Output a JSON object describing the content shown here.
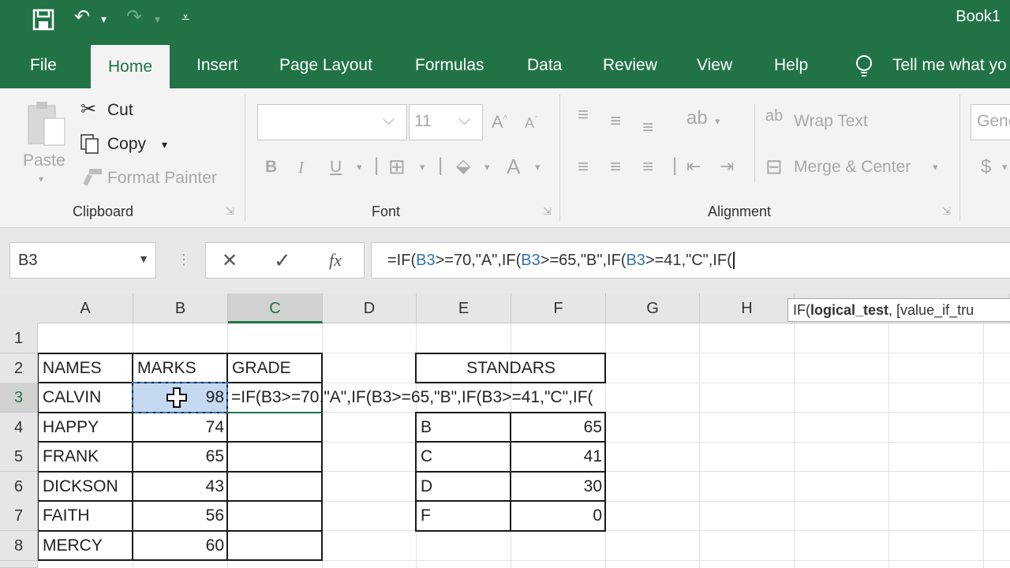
{
  "window": {
    "title": "Book1"
  },
  "qat": {
    "save_icon": "save-icon",
    "undo_icon": "undo-icon",
    "redo_icon": "redo-icon",
    "customize_icon": "customize-qat-icon"
  },
  "menu": {
    "tabs": [
      "File",
      "Home",
      "Insert",
      "Page Layout",
      "Formulas",
      "Data",
      "Review",
      "View",
      "Help"
    ],
    "active": "Home",
    "tell_me": "Tell me what yo"
  },
  "ribbon": {
    "clipboard": {
      "paste": "Paste",
      "cut": "Cut",
      "copy": "Copy",
      "format_painter": "Format Painter",
      "label": "Clipboard"
    },
    "font": {
      "font_size": "11",
      "label": "Font",
      "bold": "B",
      "italic": "I",
      "underline": "U",
      "font_color": "A"
    },
    "alignment": {
      "wrap_text": "Wrap Text",
      "merge_center": "Merge & Center",
      "label": "Alignment"
    },
    "number": {
      "format": "Gene",
      "currency": "$"
    }
  },
  "formula_bar": {
    "name_box": "B3",
    "cancel": "✕",
    "enter": "✓",
    "fx": "fx",
    "parts": [
      "=IF(",
      "B3",
      ">=70,\"A\",IF(",
      "B3",
      ">=65,\"B\",IF(",
      "B3",
      ">=41,\"C\",IF("
    ]
  },
  "tooltip": {
    "func": "IF(",
    "arg": "logical_test",
    "rest": ", [value_if_tru"
  },
  "sheet": {
    "columns": [
      "A",
      "B",
      "C",
      "D",
      "E",
      "F",
      "G",
      "H"
    ],
    "rows": [
      "1",
      "2",
      "3",
      "4",
      "5",
      "6",
      "7",
      "8"
    ],
    "headers": {
      "names": "NAMES",
      "marks": "MARKS",
      "grade": "GRADE"
    },
    "students": [
      {
        "name": "CALVIN",
        "marks": "98"
      },
      {
        "name": "HAPPY",
        "marks": "74"
      },
      {
        "name": "FRANK",
        "marks": "65"
      },
      {
        "name": "DICKSON",
        "marks": "43"
      },
      {
        "name": "FAITH",
        "marks": "56"
      },
      {
        "name": "MERCY",
        "marks": "60"
      }
    ],
    "editing_formula": "=IF(B3>=70,\"A\",IF(B3>=65,\"B\",IF(B3>=41,\"C\",IF(",
    "standards_title": "STANDARS",
    "standards": [
      {
        "grade": "B",
        "min": "65"
      },
      {
        "grade": "C",
        "min": "41"
      },
      {
        "grade": "D",
        "min": "30"
      },
      {
        "grade": "F",
        "min": "0"
      }
    ]
  }
}
